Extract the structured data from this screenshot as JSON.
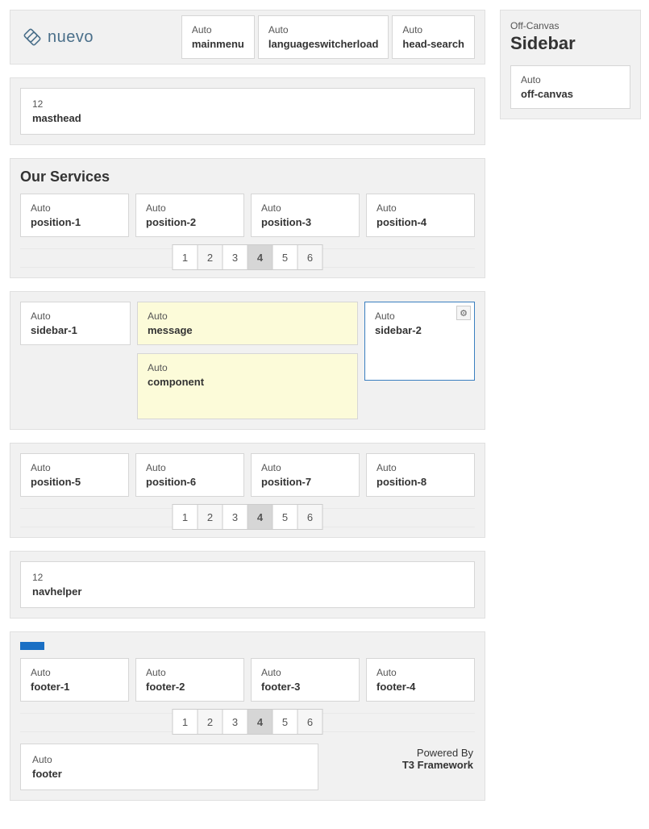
{
  "logo_text": "nuevo",
  "header_mods": [
    {
      "top": "Auto",
      "name": "mainmenu"
    },
    {
      "top": "Auto",
      "name": "languageswitcherload"
    },
    {
      "top": "Auto",
      "name": "head-search"
    }
  ],
  "masthead": {
    "top": "12",
    "name": "masthead"
  },
  "services": {
    "title": "Our Services",
    "positions": [
      {
        "top": "Auto",
        "name": "position-1"
      },
      {
        "top": "Auto",
        "name": "position-2"
      },
      {
        "top": "Auto",
        "name": "position-3"
      },
      {
        "top": "Auto",
        "name": "position-4"
      }
    ],
    "pager": [
      "1",
      "2",
      "3",
      "4",
      "5",
      "6"
    ],
    "pager_active": "4"
  },
  "mainbody": {
    "left": {
      "top": "Auto",
      "name": "sidebar-1"
    },
    "message": {
      "top": "Auto",
      "name": "message"
    },
    "component": {
      "top": "Auto",
      "name": "component"
    },
    "right": {
      "top": "Auto",
      "name": "sidebar-2"
    }
  },
  "spotlight2": {
    "positions": [
      {
        "top": "Auto",
        "name": "position-5"
      },
      {
        "top": "Auto",
        "name": "position-6"
      },
      {
        "top": "Auto",
        "name": "position-7"
      },
      {
        "top": "Auto",
        "name": "position-8"
      }
    ],
    "pager": [
      "1",
      "2",
      "3",
      "4",
      "5",
      "6"
    ],
    "pager_active": "4"
  },
  "navhelper": {
    "top": "12",
    "name": "navhelper"
  },
  "footer": {
    "positions": [
      {
        "top": "Auto",
        "name": "footer-1"
      },
      {
        "top": "Auto",
        "name": "footer-2"
      },
      {
        "top": "Auto",
        "name": "footer-3"
      },
      {
        "top": "Auto",
        "name": "footer-4"
      }
    ],
    "pager": [
      "1",
      "2",
      "3",
      "4",
      "5",
      "6"
    ],
    "pager_active": "4",
    "footer_mod": {
      "top": "Auto",
      "name": "footer"
    },
    "credit_l1": "Powered By",
    "credit_l2": "T3 Framework"
  },
  "offcanvas": {
    "title_sm": "Off-Canvas",
    "title_lg": "Sidebar",
    "mod": {
      "top": "Auto",
      "name": "off-canvas"
    }
  },
  "gear_glyph": "⚙"
}
